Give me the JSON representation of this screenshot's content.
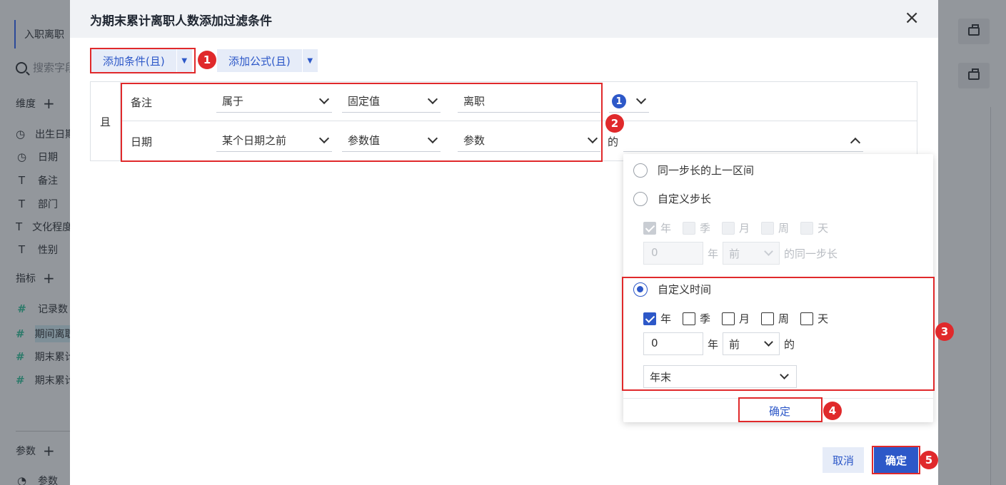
{
  "background": {
    "tab_label": "入职离职",
    "search_placeholder": "搜索字段",
    "sections": {
      "dimension": "维度",
      "indicator": "指标",
      "parameter": "参数"
    },
    "dimension_items": [
      "出生日期",
      "日期",
      "备注",
      "部门",
      "文化程度",
      "性别"
    ],
    "indicator_items": [
      "记录数",
      "期间离职",
      "期末累计",
      "期末累计"
    ],
    "parameter_items": [
      "参数"
    ]
  },
  "dialog": {
    "title": "为期末累计离职人数添加过滤条件",
    "add_condition": "添加条件(且)",
    "add_formula": "添加公式(且)",
    "and_label": "且",
    "rows": [
      {
        "field": "备注",
        "op": "属于",
        "value_type": "固定值",
        "value": "离职",
        "count": "1"
      },
      {
        "field": "日期",
        "op": "某个日期之前",
        "value_type": "参数值",
        "value": "参数",
        "suffix": "的"
      }
    ],
    "popup": {
      "option_prev": "同一步长的上一区间",
      "option_step": "自定义步长",
      "option_time": "自定义时间",
      "units": [
        "年",
        "季",
        "月",
        "周",
        "天"
      ],
      "step_value": "0",
      "step_unit": "年",
      "step_dir": "前",
      "step_suffix": "的同一步长",
      "time_value": "0",
      "time_unit": "年",
      "time_dir": "前",
      "time_suffix": "的",
      "time_point": "年末",
      "confirm": "确定"
    },
    "cancel": "取消",
    "ok": "确定"
  },
  "annotations": [
    "1",
    "2",
    "3",
    "4",
    "5"
  ],
  "colors": {
    "accent": "#2d58c8",
    "highlight": "#e0292b"
  }
}
